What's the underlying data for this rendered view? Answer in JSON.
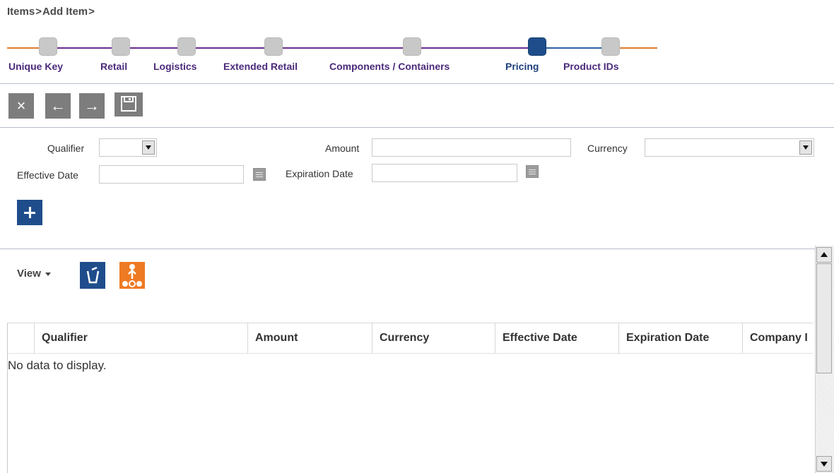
{
  "breadcrumb": {
    "items": [
      "Items",
      "Add Item"
    ],
    "separator": ">"
  },
  "train": {
    "steps": [
      {
        "label": "Unique Key",
        "current": false
      },
      {
        "label": "Retail",
        "current": false
      },
      {
        "label": "Logistics",
        "current": false
      },
      {
        "label": "Extended Retail",
        "current": false
      },
      {
        "label": "Components / Containers",
        "current": false
      },
      {
        "label": "Pricing",
        "current": true
      },
      {
        "label": "Product IDs",
        "current": false
      }
    ],
    "colors": {
      "visited_line": "#6b2c8f",
      "start_line": "#e07b2e",
      "future_line": "#2b5fa5",
      "end_line": "#e07b2e",
      "current": "#1f4d8c",
      "inactive": "#c8c8c8"
    }
  },
  "toolbar": {
    "buttons": [
      {
        "icon": "close-icon",
        "glyph": "×"
      },
      {
        "icon": "back-arrow-icon",
        "glyph": "←"
      },
      {
        "icon": "forward-arrow-icon",
        "glyph": "→"
      },
      {
        "icon": "save-icon"
      }
    ]
  },
  "form": {
    "qualifier": {
      "label": "Qualifier",
      "value": ""
    },
    "amount": {
      "label": "Amount",
      "value": ""
    },
    "currency": {
      "label": "Currency",
      "value": ""
    },
    "effective_date": {
      "label": "Effective Date",
      "value": ""
    },
    "expiration_date": {
      "label": "Expiration Date",
      "value": ""
    },
    "add_button_icon": "plus-icon"
  },
  "view_toolbar": {
    "view_label": "View",
    "icons": [
      "detach-icon",
      "hierarchy-icon"
    ]
  },
  "table": {
    "columns": [
      "",
      "Qualifier",
      "Amount",
      "Currency",
      "Effective Date",
      "Expiration Date",
      "Company I"
    ],
    "empty_text": "No data to display."
  }
}
